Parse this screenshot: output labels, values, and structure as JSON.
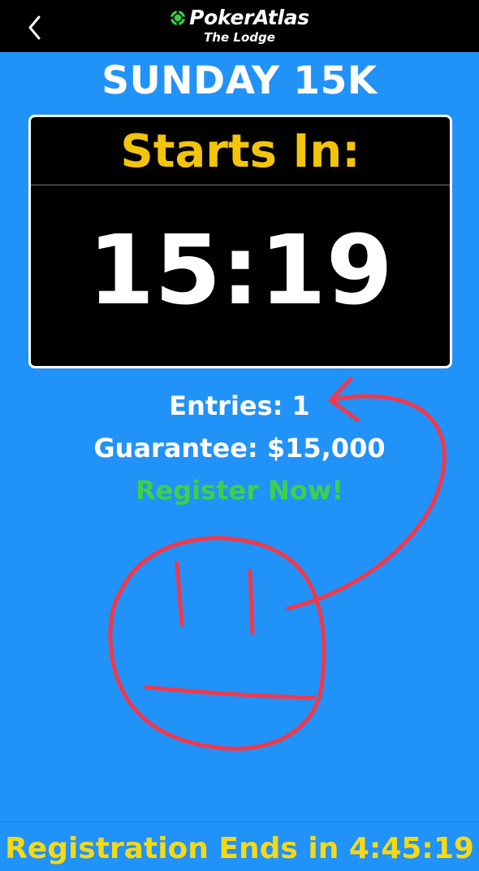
{
  "header": {
    "brand": "PokerAtlas",
    "venue": "The Lodge",
    "back_icon": "chevron-left-icon",
    "brand_icon": "poker-chip-icon"
  },
  "event": {
    "title": "SUNDAY 15K"
  },
  "timer": {
    "label": "Starts In:",
    "value": "15:19"
  },
  "details": {
    "entries": "Entries: 1",
    "guarantee": "Guarantee: $15,000",
    "register": "Register Now!"
  },
  "footer": {
    "text": "Registration Ends in 4:45:19"
  },
  "colors": {
    "background": "#2192f7",
    "timer_label": "#f2c40b",
    "register": "#3bd14a",
    "footer_text": "#f5d916",
    "annotation": "#f2384a"
  }
}
